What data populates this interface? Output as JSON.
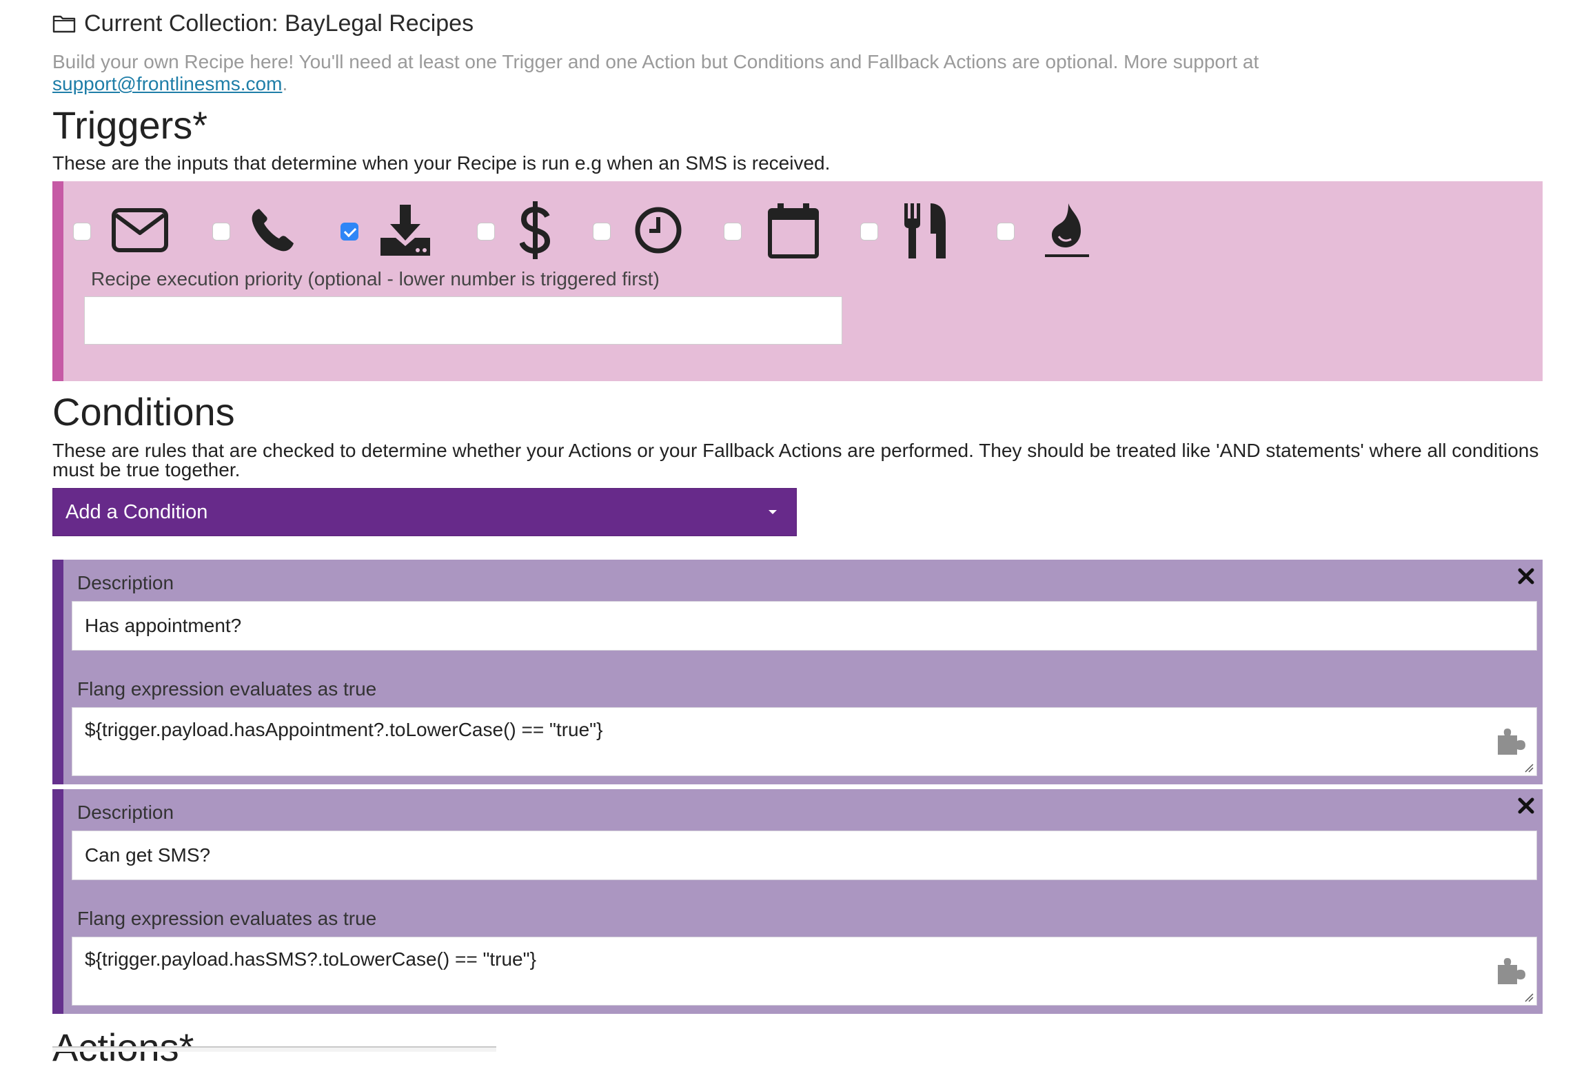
{
  "collection": {
    "label": "Current Collection: BayLegal Recipes",
    "icon": "folder-icon"
  },
  "intro": {
    "text": "Build your own Recipe here! You'll need at least one Trigger and one Action but Conditions and Fallback Actions are optional. More support at",
    "link": "support@frontlinesms.com",
    "suffix": "."
  },
  "triggers": {
    "heading": "Triggers*",
    "description": "These are the inputs that determine when your Recipe is run e.g when an SMS is received.",
    "panel_color": "#e6bdd8",
    "accent_color": "#c65aa5",
    "items": [
      {
        "icon": "envelope-icon",
        "checked": false
      },
      {
        "icon": "phone-icon",
        "checked": false
      },
      {
        "icon": "download-icon",
        "checked": true
      },
      {
        "icon": "dollar-icon",
        "checked": false
      },
      {
        "icon": "clock-icon",
        "checked": false
      },
      {
        "icon": "calendar-icon",
        "checked": false
      },
      {
        "icon": "cutlery-icon",
        "checked": false
      },
      {
        "icon": "drupal-icon",
        "checked": false
      }
    ],
    "priority_label": "Recipe execution priority (optional - lower number is triggered first)",
    "priority_value": ""
  },
  "conditions": {
    "heading": "Conditions",
    "description": "These are rules that are checked to determine whether your Actions or your Fallback Actions are performed. They should be treated like 'AND statements' where all conditions must be true together.",
    "add_label": "Add a Condition",
    "button_color": "#672a8a",
    "block_color": "#ab96c1",
    "items": [
      {
        "description_label": "Description",
        "description_value": "Has appointment?",
        "expression_label": "Flang expression evaluates as true",
        "expression_value": "${trigger.payload.hasAppointment?.toLowerCase() == \"true\"}"
      },
      {
        "description_label": "Description",
        "description_value": "Can get SMS?",
        "expression_label": "Flang expression evaluates as true",
        "expression_value": "${trigger.payload.hasSMS?.toLowerCase() == \"true\"}"
      }
    ]
  },
  "actions": {
    "heading": "Actions*"
  }
}
